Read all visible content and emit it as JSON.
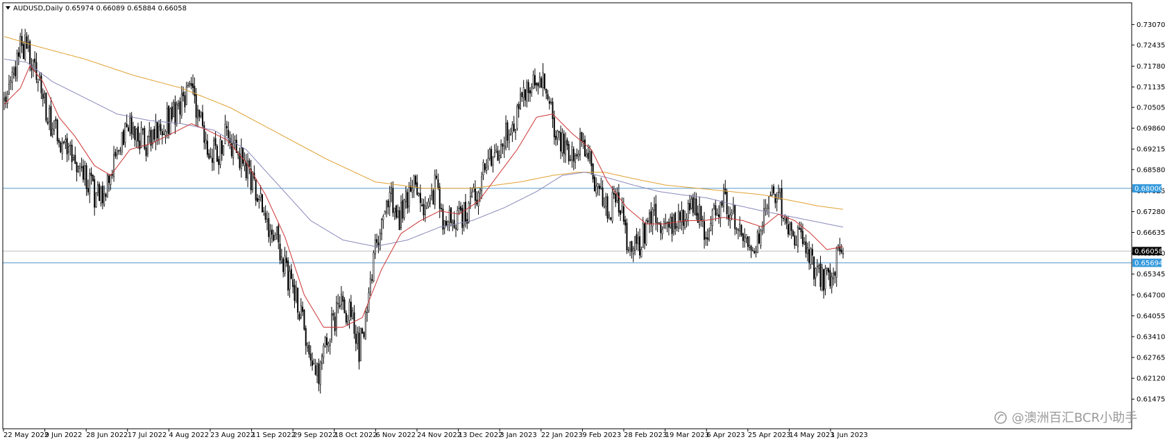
{
  "header": {
    "symbol": "AUDUSD,Daily",
    "ohlc": "0.65974 0.66089 0.65884 0.66058"
  },
  "watermark": "@澳洲百汇BCR小助手",
  "colors": {
    "background": "#ffffff",
    "candle": "#000000",
    "ma_short": "#cc3333",
    "ma_mid": "#8888bb",
    "ma_long": "#e0a030",
    "hline_level": "#5599cc",
    "hline_price": "#c0c0c0",
    "label_level_bg": "#3399dd",
    "label_price_bg": "#000000"
  },
  "chart_data": {
    "type": "candlestick",
    "symbol": "AUDUSD",
    "timeframe": "Daily",
    "ylim": [
      0.6148,
      0.734
    ],
    "grid": false,
    "y_ticks": [
      "0.73070",
      "0.72435",
      "0.71780",
      "0.71135",
      "0.70505",
      "0.69860",
      "0.69215",
      "0.68580",
      "0.67925",
      "0.67280",
      "0.66635",
      "0.65990",
      "0.65345",
      "0.64700",
      "0.64055",
      "0.63410",
      "0.62765",
      "0.62120",
      "0.61475"
    ],
    "x_ticks": [
      "22 May 2022",
      "9 Jun 2022",
      "28 Jun 2022",
      "17 Jul 2022",
      "4 Aug 2022",
      "23 Aug 2022",
      "11 Sep 2022",
      "29 Sep 2022",
      "18 Oct 2022",
      "6 Nov 2022",
      "24 Nov 2022",
      "13 Dec 2022",
      "3 Jan 2023",
      "22 Jan 2023",
      "9 Feb 2023",
      "28 Feb 2023",
      "19 Mar 2023",
      "6 Apr 2023",
      "25 Apr 2023",
      "14 May 2023",
      "1 Jun 2023"
    ],
    "levels": [
      {
        "value": 0.68,
        "label": "0.68000",
        "kind": "level"
      },
      {
        "value": 0.65694,
        "label": "0.65694",
        "kind": "level"
      },
      {
        "value": 0.66058,
        "label": "0.66058",
        "kind": "price"
      }
    ],
    "close_path": [
      [
        0,
        0.7065
      ],
      [
        7,
        0.719
      ],
      [
        10,
        0.725
      ],
      [
        14,
        0.723
      ],
      [
        18,
        0.718
      ],
      [
        23,
        0.71
      ],
      [
        29,
        0.699
      ],
      [
        38,
        0.693
      ],
      [
        45,
        0.686
      ],
      [
        53,
        0.682
      ],
      [
        57,
        0.677
      ],
      [
        62,
        0.678
      ],
      [
        66,
        0.686
      ],
      [
        72,
        0.695
      ],
      [
        80,
        0.699
      ],
      [
        88,
        0.693
      ],
      [
        96,
        0.698
      ],
      [
        104,
        0.702
      ],
      [
        112,
        0.708
      ],
      [
        116,
        0.712
      ],
      [
        121,
        0.702
      ],
      [
        127,
        0.692
      ],
      [
        132,
        0.69
      ],
      [
        137,
        0.696
      ],
      [
        143,
        0.692
      ],
      [
        150,
        0.686
      ],
      [
        156,
        0.68
      ],
      [
        162,
        0.67
      ],
      [
        168,
        0.666
      ],
      [
        172,
        0.659
      ],
      [
        176,
        0.652
      ],
      [
        180,
        0.647
      ],
      [
        184,
        0.642
      ],
      [
        187,
        0.633
      ],
      [
        191,
        0.625
      ],
      [
        195,
        0.623
      ],
      [
        198,
        0.628
      ],
      [
        203,
        0.638
      ],
      [
        210,
        0.644
      ],
      [
        217,
        0.639
      ],
      [
        220,
        0.63
      ],
      [
        225,
        0.643
      ],
      [
        230,
        0.66
      ],
      [
        234,
        0.672
      ],
      [
        240,
        0.678
      ],
      [
        244,
        0.67
      ],
      [
        248,
        0.674
      ],
      [
        252,
        0.679
      ],
      [
        257,
        0.682
      ],
      [
        262,
        0.67
      ],
      [
        268,
        0.682
      ],
      [
        272,
        0.67
      ],
      [
        280,
        0.669
      ],
      [
        286,
        0.672
      ],
      [
        292,
        0.678
      ],
      [
        300,
        0.688
      ],
      [
        306,
        0.692
      ],
      [
        312,
        0.698
      ],
      [
        318,
        0.703
      ],
      [
        324,
        0.709
      ],
      [
        329,
        0.713
      ],
      [
        334,
        0.714
      ],
      [
        338,
        0.705
      ],
      [
        343,
        0.695
      ],
      [
        348,
        0.694
      ],
      [
        353,
        0.69
      ],
      [
        358,
        0.694
      ],
      [
        364,
        0.686
      ],
      [
        369,
        0.678
      ],
      [
        374,
        0.673
      ],
      [
        380,
        0.677
      ],
      [
        386,
        0.665
      ],
      [
        392,
        0.661
      ],
      [
        398,
        0.668
      ],
      [
        404,
        0.672
      ],
      [
        410,
        0.665
      ],
      [
        416,
        0.67
      ],
      [
        422,
        0.673
      ],
      [
        428,
        0.676
      ],
      [
        434,
        0.666
      ],
      [
        440,
        0.672
      ],
      [
        446,
        0.676
      ],
      [
        452,
        0.671
      ],
      [
        458,
        0.664
      ],
      [
        464,
        0.66
      ],
      [
        470,
        0.669
      ],
      [
        476,
        0.678
      ],
      [
        480,
        0.68
      ],
      [
        484,
        0.67
      ],
      [
        488,
        0.664
      ],
      [
        494,
        0.665
      ],
      [
        500,
        0.66
      ],
      [
        503,
        0.654
      ],
      [
        508,
        0.651
      ],
      [
        512,
        0.652
      ],
      [
        514,
        0.654
      ],
      [
        516,
        0.659
      ],
      [
        520,
        0.6606
      ]
    ],
    "ma_short": [
      [
        0,
        0.706
      ],
      [
        10,
        0.711
      ],
      [
        16,
        0.718
      ],
      [
        24,
        0.713
      ],
      [
        34,
        0.702
      ],
      [
        44,
        0.696
      ],
      [
        56,
        0.687
      ],
      [
        66,
        0.684
      ],
      [
        78,
        0.692
      ],
      [
        92,
        0.694
      ],
      [
        104,
        0.697
      ],
      [
        116,
        0.7
      ],
      [
        126,
        0.698
      ],
      [
        138,
        0.695
      ],
      [
        150,
        0.688
      ],
      [
        162,
        0.678
      ],
      [
        174,
        0.665
      ],
      [
        186,
        0.647
      ],
      [
        198,
        0.637
      ],
      [
        210,
        0.637
      ],
      [
        222,
        0.64
      ],
      [
        234,
        0.655
      ],
      [
        246,
        0.666
      ],
      [
        258,
        0.67
      ],
      [
        270,
        0.673
      ],
      [
        282,
        0.672
      ],
      [
        294,
        0.676
      ],
      [
        306,
        0.684
      ],
      [
        318,
        0.692
      ],
      [
        330,
        0.702
      ],
      [
        340,
        0.703
      ],
      [
        352,
        0.697
      ],
      [
        364,
        0.692
      ],
      [
        374,
        0.682
      ],
      [
        386,
        0.674
      ],
      [
        398,
        0.669
      ],
      [
        410,
        0.669
      ],
      [
        422,
        0.67
      ],
      [
        434,
        0.67
      ],
      [
        446,
        0.671
      ],
      [
        458,
        0.67
      ],
      [
        470,
        0.668
      ],
      [
        480,
        0.672
      ],
      [
        490,
        0.67
      ],
      [
        500,
        0.666
      ],
      [
        510,
        0.661
      ],
      [
        520,
        0.662
      ]
    ],
    "ma_mid": [
      [
        0,
        0.72
      ],
      [
        14,
        0.719
      ],
      [
        30,
        0.713
      ],
      [
        50,
        0.708
      ],
      [
        70,
        0.703
      ],
      [
        90,
        0.701
      ],
      [
        110,
        0.7
      ],
      [
        130,
        0.698
      ],
      [
        150,
        0.692
      ],
      [
        170,
        0.681
      ],
      [
        190,
        0.67
      ],
      [
        210,
        0.664
      ],
      [
        230,
        0.662
      ],
      [
        250,
        0.664
      ],
      [
        270,
        0.668
      ],
      [
        290,
        0.67
      ],
      [
        310,
        0.674
      ],
      [
        330,
        0.679
      ],
      [
        346,
        0.684
      ],
      [
        360,
        0.685
      ],
      [
        376,
        0.683
      ],
      [
        390,
        0.681
      ],
      [
        406,
        0.679
      ],
      [
        420,
        0.678
      ],
      [
        436,
        0.677
      ],
      [
        452,
        0.675
      ],
      [
        470,
        0.673
      ],
      [
        490,
        0.671
      ],
      [
        505,
        0.6695
      ],
      [
        520,
        0.668
      ]
    ],
    "ma_long": [
      [
        0,
        0.727
      ],
      [
        20,
        0.724
      ],
      [
        50,
        0.72
      ],
      [
        80,
        0.715
      ],
      [
        110,
        0.711
      ],
      [
        140,
        0.705
      ],
      [
        170,
        0.697
      ],
      [
        200,
        0.689
      ],
      [
        230,
        0.682
      ],
      [
        260,
        0.68
      ],
      [
        290,
        0.68
      ],
      [
        320,
        0.682
      ],
      [
        340,
        0.684
      ],
      [
        356,
        0.685
      ],
      [
        372,
        0.685
      ],
      [
        390,
        0.683
      ],
      [
        410,
        0.681
      ],
      [
        430,
        0.68
      ],
      [
        450,
        0.679
      ],
      [
        470,
        0.678
      ],
      [
        490,
        0.676
      ],
      [
        505,
        0.6745
      ],
      [
        520,
        0.6735
      ]
    ]
  }
}
